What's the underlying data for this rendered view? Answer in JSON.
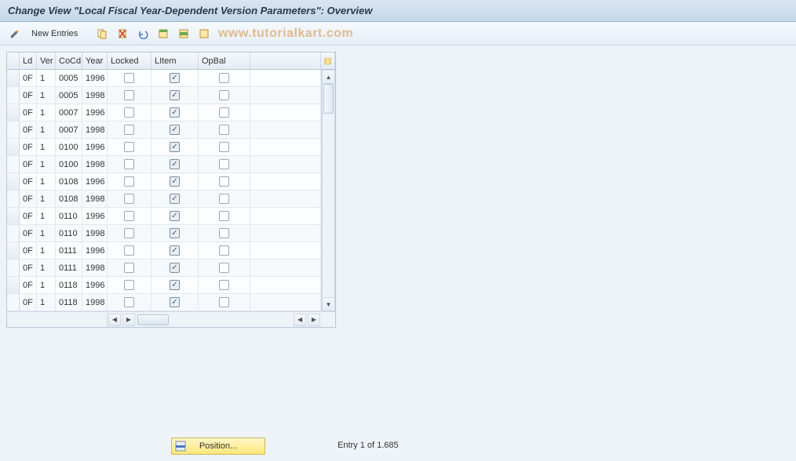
{
  "header": {
    "title": "Change View \"Local Fiscal Year-Dependent Version Parameters\": Overview"
  },
  "toolbar": {
    "new_entries_label": "New Entries"
  },
  "watermark": "www.tutorialkart.com",
  "grid": {
    "columns": {
      "ld": "Ld",
      "ver": "Ver",
      "cocd": "CoCd",
      "year": "Year",
      "locked": "Locked",
      "litem": "LItem",
      "opbal": "OpBal"
    },
    "rows": [
      {
        "ld": "0F",
        "ver": "1",
        "cocd": "0005",
        "year": "1996",
        "locked": false,
        "litem": true,
        "opbal": false
      },
      {
        "ld": "0F",
        "ver": "1",
        "cocd": "0005",
        "year": "1998",
        "locked": false,
        "litem": true,
        "opbal": false
      },
      {
        "ld": "0F",
        "ver": "1",
        "cocd": "0007",
        "year": "1996",
        "locked": false,
        "litem": true,
        "opbal": false
      },
      {
        "ld": "0F",
        "ver": "1",
        "cocd": "0007",
        "year": "1998",
        "locked": false,
        "litem": true,
        "opbal": false
      },
      {
        "ld": "0F",
        "ver": "1",
        "cocd": "0100",
        "year": "1996",
        "locked": false,
        "litem": true,
        "opbal": false
      },
      {
        "ld": "0F",
        "ver": "1",
        "cocd": "0100",
        "year": "1998",
        "locked": false,
        "litem": true,
        "opbal": false
      },
      {
        "ld": "0F",
        "ver": "1",
        "cocd": "0108",
        "year": "1996",
        "locked": false,
        "litem": true,
        "opbal": false
      },
      {
        "ld": "0F",
        "ver": "1",
        "cocd": "0108",
        "year": "1998",
        "locked": false,
        "litem": true,
        "opbal": false
      },
      {
        "ld": "0F",
        "ver": "1",
        "cocd": "0110",
        "year": "1996",
        "locked": false,
        "litem": true,
        "opbal": false
      },
      {
        "ld": "0F",
        "ver": "1",
        "cocd": "0110",
        "year": "1998",
        "locked": false,
        "litem": true,
        "opbal": false
      },
      {
        "ld": "0F",
        "ver": "1",
        "cocd": "0111",
        "year": "1996",
        "locked": false,
        "litem": true,
        "opbal": false
      },
      {
        "ld": "0F",
        "ver": "1",
        "cocd": "0111",
        "year": "1998",
        "locked": false,
        "litem": true,
        "opbal": false
      },
      {
        "ld": "0F",
        "ver": "1",
        "cocd": "0118",
        "year": "1996",
        "locked": false,
        "litem": true,
        "opbal": false
      },
      {
        "ld": "0F",
        "ver": "1",
        "cocd": "0118",
        "year": "1998",
        "locked": false,
        "litem": true,
        "opbal": false
      }
    ]
  },
  "footer": {
    "position_label": "Position...",
    "entry_status": "Entry 1 of 1.685"
  }
}
